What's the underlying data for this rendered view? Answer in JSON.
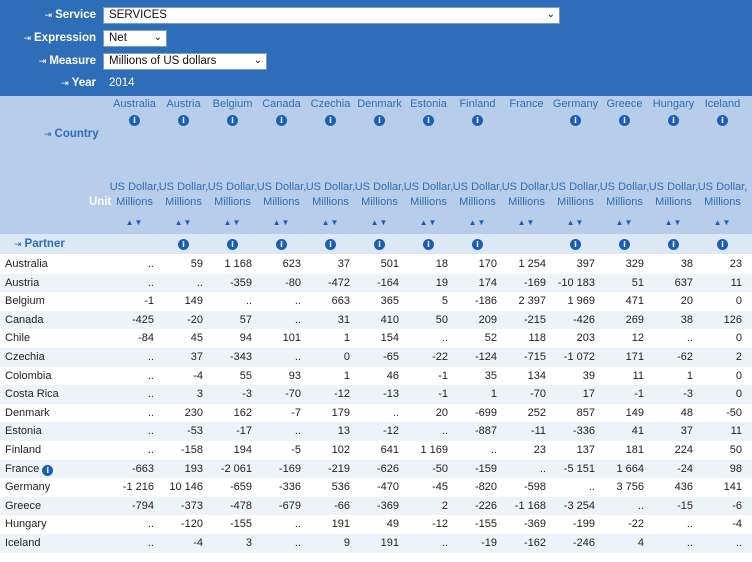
{
  "filters": {
    "service": {
      "label": "Service",
      "value": "SERVICES"
    },
    "expression": {
      "label": "Expression",
      "value": "Net"
    },
    "measure": {
      "label": "Measure",
      "value": "Millions of US dollars"
    },
    "year": {
      "label": "Year",
      "value": "2014"
    }
  },
  "header": {
    "country_label": "Country",
    "unit_label": "Unit",
    "partner_label": "Partner",
    "unit_text_line1": "US Dollar,",
    "unit_text_line2": "Millions",
    "sort_glyph": "▲▼",
    "info_glyph": "i"
  },
  "columns": [
    {
      "name": "Australia",
      "info": true,
      "partner_info": false
    },
    {
      "name": "Austria",
      "info": true,
      "partner_info": true
    },
    {
      "name": "Belgium",
      "info": true,
      "partner_info": true
    },
    {
      "name": "Canada",
      "info": true,
      "partner_info": true
    },
    {
      "name": "Czechia",
      "info": true,
      "partner_info": true
    },
    {
      "name": "Denmark",
      "info": true,
      "partner_info": true
    },
    {
      "name": "Estonia",
      "info": true,
      "partner_info": true
    },
    {
      "name": "Finland",
      "info": true,
      "partner_info": true
    },
    {
      "name": "France",
      "info": false,
      "partner_info": false
    },
    {
      "name": "Germany",
      "info": true,
      "partner_info": true
    },
    {
      "name": "Greece",
      "info": true,
      "partner_info": true
    },
    {
      "name": "Hungary",
      "info": true,
      "partner_info": true
    },
    {
      "name": "Iceland",
      "info": true,
      "partner_info": true
    }
  ],
  "rows": [
    {
      "name": "Australia",
      "info": false,
      "values": [
        "..",
        "59",
        "1 168",
        "623",
        "37",
        "501",
        "18",
        "170",
        "1 254",
        "397",
        "329",
        "38",
        "23"
      ]
    },
    {
      "name": "Austria",
      "info": false,
      "values": [
        "..",
        "..",
        "-359",
        "-80",
        "-472",
        "-164",
        "19",
        "174",
        "-169",
        "-10 183",
        "51",
        "637",
        "11"
      ]
    },
    {
      "name": "Belgium",
      "info": false,
      "values": [
        "-1",
        "149",
        "..",
        "..",
        "663",
        "365",
        "5",
        "-186",
        "2 397",
        "1 969",
        "471",
        "20",
        "0"
      ]
    },
    {
      "name": "Canada",
      "info": false,
      "values": [
        "-425",
        "-20",
        "57",
        "..",
        "31",
        "410",
        "50",
        "209",
        "-215",
        "-426",
        "269",
        "38",
        "126"
      ]
    },
    {
      "name": "Chile",
      "info": false,
      "values": [
        "-84",
        "45",
        "94",
        "101",
        "1",
        "154",
        "..",
        "52",
        "118",
        "203",
        "12",
        "..",
        "0"
      ]
    },
    {
      "name": "Czechia",
      "info": false,
      "values": [
        "..",
        "37",
        "-343",
        "..",
        "0",
        "-65",
        "-22",
        "-124",
        "-715",
        "-1 072",
        "171",
        "-62",
        "2"
      ]
    },
    {
      "name": "Colombia",
      "info": false,
      "values": [
        "..",
        "-4",
        "55",
        "93",
        "1",
        "46",
        "-1",
        "35",
        "134",
        "39",
        "11",
        "1",
        "0"
      ]
    },
    {
      "name": "Costa Rica",
      "info": false,
      "values": [
        "..",
        "3",
        "-3",
        "-70",
        "-12",
        "-13",
        "-1",
        "1",
        "-70",
        "17",
        "-1",
        "-3",
        "0"
      ]
    },
    {
      "name": "Denmark",
      "info": false,
      "values": [
        "..",
        "230",
        "162",
        "-7",
        "179",
        "..",
        "20",
        "-699",
        "252",
        "857",
        "149",
        "48",
        "-50"
      ]
    },
    {
      "name": "Estonia",
      "info": false,
      "values": [
        "..",
        "-53",
        "-17",
        "..",
        "13",
        "-12",
        "..",
        "-887",
        "-11",
        "-336",
        "41",
        "37",
        "11"
      ]
    },
    {
      "name": "Finland",
      "info": false,
      "values": [
        "..",
        "-158",
        "194",
        "-5",
        "102",
        "641",
        "1 169",
        "..",
        "23",
        "137",
        "181",
        "224",
        "50"
      ]
    },
    {
      "name": "France",
      "info": true,
      "values": [
        "-663",
        "193",
        "-2 061",
        "-169",
        "-219",
        "-626",
        "-50",
        "-159",
        "..",
        "-5 151",
        "1 664",
        "-24",
        "98"
      ]
    },
    {
      "name": "Germany",
      "info": false,
      "values": [
        "-1 216",
        "10 146",
        "-659",
        "-336",
        "536",
        "-470",
        "-45",
        "-820",
        "-598",
        "..",
        "3 756",
        "436",
        "141"
      ]
    },
    {
      "name": "Greece",
      "info": false,
      "values": [
        "-794",
        "-373",
        "-478",
        "-679",
        "-66",
        "-369",
        "2",
        "-226",
        "-1 168",
        "-3 254",
        "..",
        "-15",
        "-6"
      ]
    },
    {
      "name": "Hungary",
      "info": false,
      "values": [
        "..",
        "-120",
        "-155",
        "..",
        "191",
        "49",
        "-12",
        "-155",
        "-369",
        "-199",
        "-22",
        "..",
        "-4"
      ]
    },
    {
      "name": "Iceland",
      "info": false,
      "values": [
        "..",
        "-4",
        "3",
        "..",
        "9",
        "191",
        "..",
        "-19",
        "-162",
        "-246",
        "4",
        "..",
        ".."
      ]
    }
  ]
}
